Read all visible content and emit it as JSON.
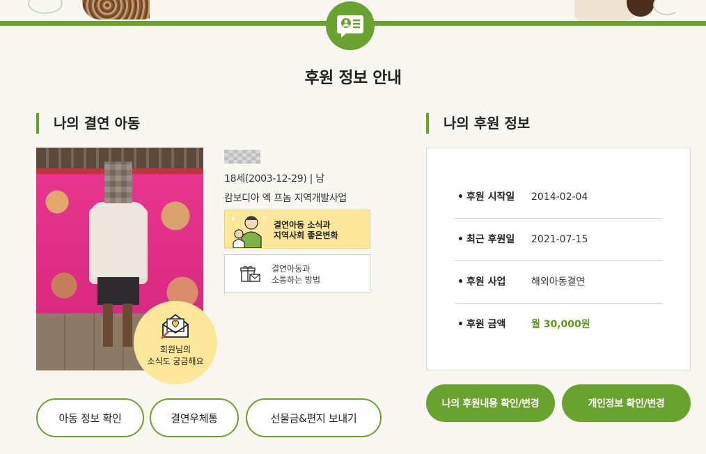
{
  "page": {
    "title": "후원 정보 안내"
  },
  "colors": {
    "accent": "#6aa22f",
    "background": "#f8f7f1",
    "highlight_yellow": "#fde79a"
  },
  "child_section": {
    "heading": "나의 결연 아동",
    "name_hidden": "",
    "age_gender": "18세(2003-12-29) | 남",
    "project": "캄보디아 엑 프놈 지역개발사업",
    "news_bubble": {
      "icon": "envelope-heart-icon",
      "line1": "회원님의",
      "line2": "소식도 궁금해요"
    },
    "news_card": {
      "icon": "child-illustration-icon",
      "line1": "결연아동 소식과",
      "line2": "지역사회 좋은변화"
    },
    "contact_card": {
      "icon": "gift-mail-icon",
      "line1": "결연아동과",
      "line2": "소통하는 방법"
    },
    "buttons": {
      "child_info": "아동 정보 확인",
      "post_box": "결연우체통",
      "gift_letter": "선물금&편지 보내기"
    }
  },
  "sponsor_section": {
    "heading": "나의 후원 정보",
    "rows": [
      {
        "label": "후원 시작일",
        "value": "2014-02-04"
      },
      {
        "label": "최근 후원일",
        "value": "2021-07-15"
      },
      {
        "label": "후원 사업",
        "value": "해외아동결연"
      },
      {
        "label": "후원 금액",
        "value": "월 30,000원"
      }
    ],
    "buttons": {
      "sponsor_manage": "나의 후원내용 확인/변경",
      "personal_info": "개인정보 확인/변경"
    }
  }
}
